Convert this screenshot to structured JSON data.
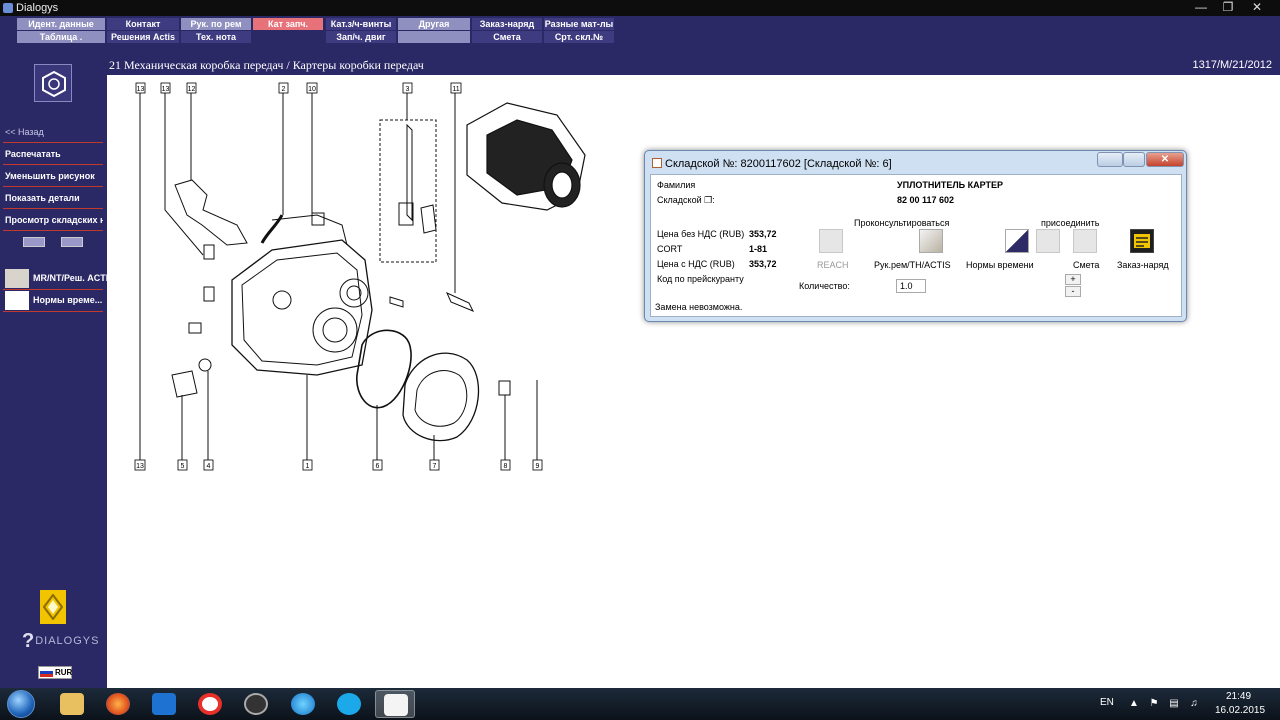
{
  "window": {
    "title": "Dialogys"
  },
  "menu": {
    "row1": [
      "Идент. данные",
      "Контакт",
      "Рук. по рем",
      "Кат запч.",
      "Кат.з/ч-винты",
      "Другая",
      "Заказ-наряд",
      "Разные мат-лы"
    ],
    "row2": [
      "Таблица .",
      "Решения Actis",
      "Тех. нота",
      "",
      "Зап/ч. двиг",
      "",
      "Смета",
      "Срт. скл.№"
    ],
    "active": "Кат запч."
  },
  "sidebar": {
    "back": "<< Назад",
    "items": [
      "Распечатать",
      "Уменьшить рисунок",
      "Показать детали",
      "Просмотр складских но..."
    ],
    "tools": [
      "MR/NT/Реш. ACTIS",
      "Нормы време..."
    ],
    "logo_text": "DIALOGYS",
    "currency": "RUR"
  },
  "page": {
    "title": "21 Механическая коробка передач / Картеры коробки передач",
    "code": "1317/M/21/2012"
  },
  "diagram": {
    "callouts": [
      "13",
      "13",
      "12",
      "2",
      "10",
      "3",
      "11",
      "13",
      "5",
      "4",
      "1",
      "6",
      "7",
      "8",
      "9"
    ]
  },
  "dialog": {
    "title": "Складской №: 8200117602 [Складской №: 6]",
    "family_label": "Фамилия",
    "family_value": "УПЛОТНИТЕЛЬ КАРТЕР",
    "sklad_label": "Складской",
    "sklad_value": "82 00 117 602",
    "consult_label": "Проконсультироваться",
    "attach_label": "присоединить",
    "price_net_label": "Цена без НДС (RUB)",
    "price_net_value": "353,72",
    "cort_label": "CORT",
    "cort_value": "1-81",
    "price_vat_label": "Цена с НДС (RUB)",
    "price_vat_value": "353,72",
    "price_code_label": "Код по прейскуранту",
    "qty_label": "Количество:",
    "qty_value": "1.0",
    "buttons": {
      "reach": "REACH",
      "manual": "Рук.рем/TH/ACTIS",
      "norms": "Нормы времени",
      "estimate": "Смета",
      "order": "Заказ-наряд"
    },
    "spin_plus": "+",
    "spin_minus": "-",
    "status": "Замена невозможна."
  },
  "taskbar": {
    "lang": "EN",
    "time": "21:49",
    "date": "16.02.2015"
  }
}
